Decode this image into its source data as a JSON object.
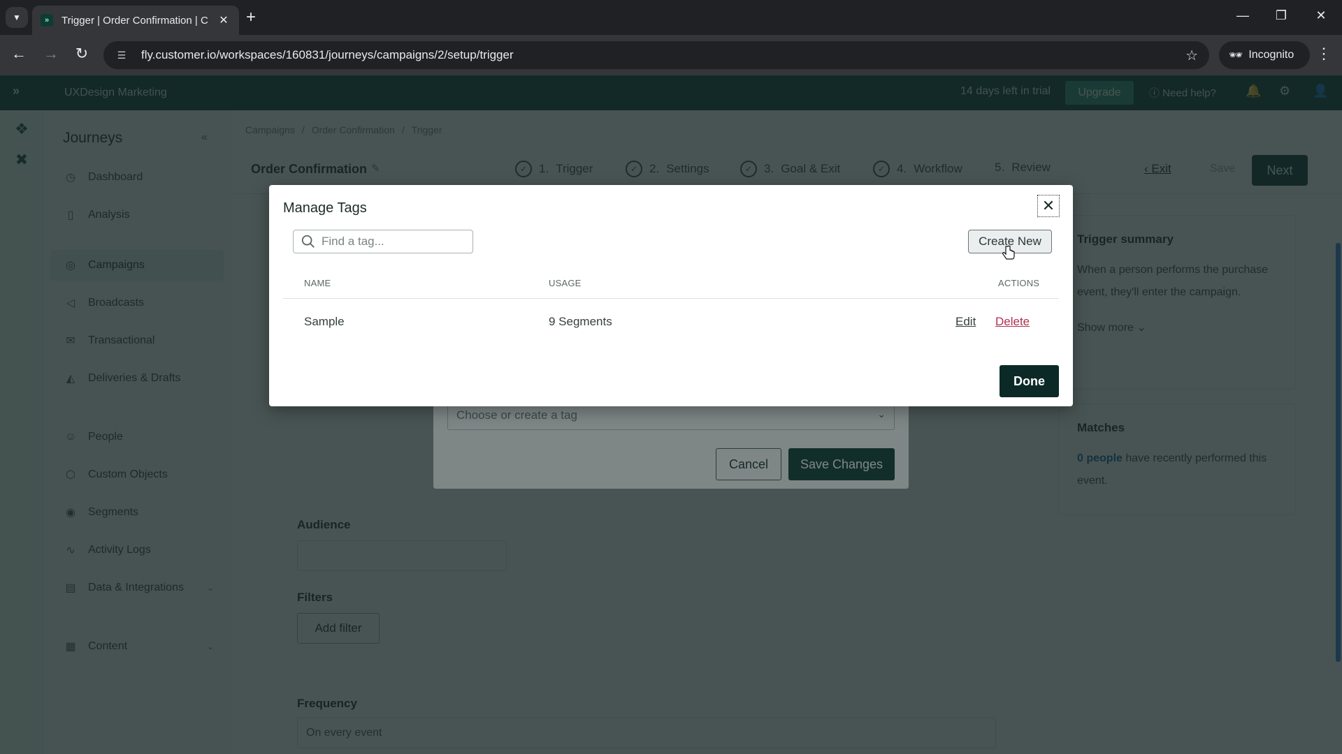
{
  "browser": {
    "tab_title": "Trigger | Order Confirmation | C",
    "url": "fly.customer.io/workspaces/160831/journeys/campaigns/2/setup/trigger",
    "incognito_label": "Incognito"
  },
  "topbar": {
    "workspace": "UXDesign Marketing",
    "trial_text": "14 days left in trial",
    "upgrade_label": "Upgrade",
    "help_label": "Need help?"
  },
  "sidebar": {
    "title": "Journeys",
    "items": [
      {
        "label": "Dashboard",
        "icon": "gauge-icon"
      },
      {
        "label": "Analysis",
        "icon": "bar-chart-icon"
      },
      {
        "label": "Campaigns",
        "icon": "campaign-icon",
        "active": true
      },
      {
        "label": "Broadcasts",
        "icon": "megaphone-icon"
      },
      {
        "label": "Transactional",
        "icon": "envelope-icon"
      },
      {
        "label": "Deliveries & Drafts",
        "icon": "inbox-icon"
      },
      {
        "label": "People",
        "icon": "person-icon"
      },
      {
        "label": "Custom Objects",
        "icon": "cube-icon"
      },
      {
        "label": "Segments",
        "icon": "segment-icon"
      },
      {
        "label": "Activity Logs",
        "icon": "pulse-icon"
      },
      {
        "label": "Data & Integrations",
        "icon": "database-icon"
      },
      {
        "label": "Content",
        "icon": "content-icon"
      }
    ]
  },
  "page": {
    "breadcrumbs": [
      "Campaigns",
      "/",
      "Order Confirmation",
      "/",
      "Trigger"
    ],
    "title": "Order Confirmation",
    "steps": [
      {
        "num": "1.",
        "label": "Trigger"
      },
      {
        "num": "2.",
        "label": "Settings"
      },
      {
        "num": "3.",
        "label": "Goal & Exit"
      },
      {
        "num": "4.",
        "label": "Workflow"
      },
      {
        "num": "5.",
        "label": "Review"
      }
    ],
    "exit_label": "Exit",
    "save_label": "Save",
    "next_label": "Next",
    "form": {
      "audience_label": "Audience",
      "filters_label": "Filters",
      "add_filter_label": "Add filter",
      "frequency_label": "Frequency",
      "frequency_value": "On every event"
    },
    "summary": {
      "title": "Trigger summary",
      "text": "When a person performs the purchase event, they'll enter the campaign.",
      "show_more": "Show more"
    },
    "matches": {
      "title": "Matches",
      "count": "0 people",
      "text": "have recently performed this event."
    }
  },
  "tag_dialog": {
    "select_placeholder": "Choose or create a tag",
    "cancel_label": "Cancel",
    "save_label": "Save Changes"
  },
  "manage_tags": {
    "title": "Manage Tags",
    "search_placeholder": "Find a tag...",
    "create_new_label": "Create New",
    "columns": {
      "name": "NAME",
      "usage": "USAGE",
      "actions": "ACTIONS"
    },
    "rows": [
      {
        "name": "Sample",
        "usage": "9 Segments",
        "edit": "Edit",
        "delete": "Delete"
      }
    ],
    "done_label": "Done",
    "colors": {
      "primary": "#0b2a27",
      "delete": "#b03050"
    }
  }
}
